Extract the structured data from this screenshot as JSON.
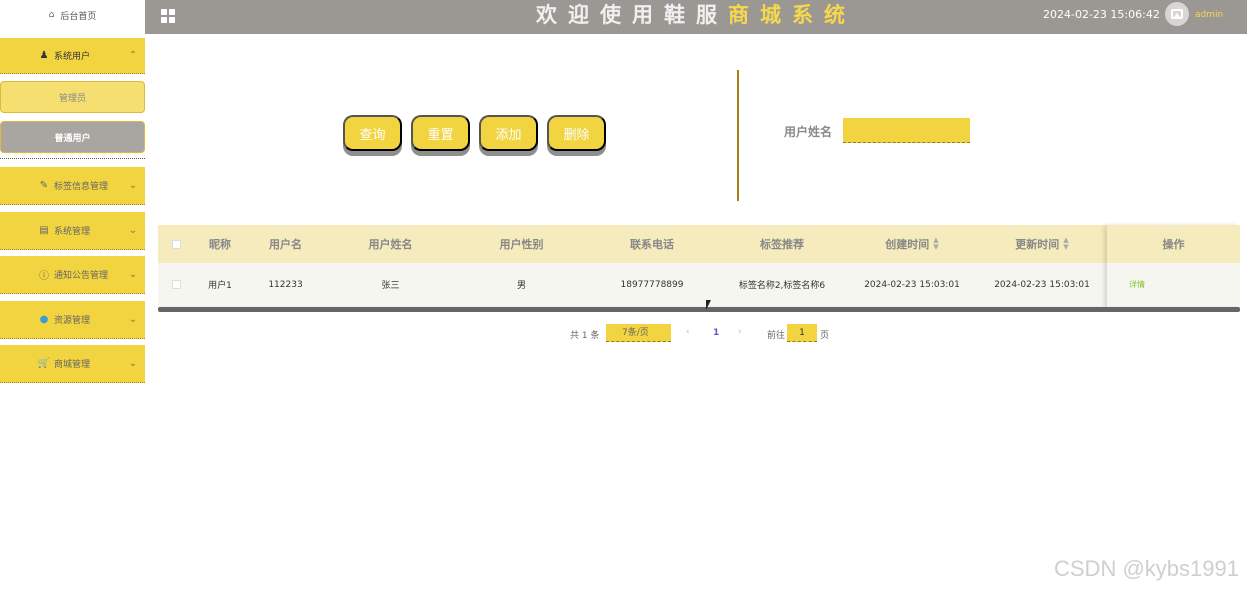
{
  "sidebar": {
    "home": {
      "label": "后台首页",
      "icon": "home-icon"
    },
    "menus": [
      {
        "label": "系统用户",
        "icon": "user-icon",
        "open": true,
        "children": [
          "管理员",
          "普通用户"
        ]
      },
      {
        "label": "标签信息管理",
        "icon": "edit-icon"
      },
      {
        "label": "系统管理",
        "icon": "chart-icon"
      },
      {
        "label": "通知公告管理",
        "icon": "info-icon"
      },
      {
        "label": "资源管理",
        "icon": "location-icon"
      },
      {
        "label": "商城管理",
        "icon": "cart-icon"
      }
    ]
  },
  "header": {
    "title_part1": "欢迎使用鞋服",
    "title_part2": "商城系统",
    "datetime": "2024-02-23 15:06:42",
    "username": "admin"
  },
  "toolbar": {
    "query": "查询",
    "reset": "重置",
    "add": "添加",
    "delete": "删除",
    "search_label": "用户姓名",
    "search_value": ""
  },
  "table": {
    "columns": [
      "昵称",
      "用户名",
      "用户姓名",
      "用户性别",
      "联系电话",
      "标签推荐",
      "创建时间",
      "更新时间",
      "操作"
    ],
    "rows": [
      {
        "nickname": "用户1",
        "username": "112233",
        "realname": "张三",
        "gender": "男",
        "phone": "18977778899",
        "tags": "标签名称2,标签名称6",
        "created": "2024-02-23 15:03:01",
        "updated": "2024-02-23 15:03:01",
        "action": "详情"
      }
    ]
  },
  "pagination": {
    "total": "共 1 条",
    "page_size": "7条/页",
    "current_page": "1",
    "goto_label": "前往",
    "goto_value": "1",
    "page_unit": "页"
  },
  "watermark": "CSDN @kybs1991",
  "colors": {
    "accent": "#f2d340",
    "header_bg": "#9b9893",
    "detail_link": "#7dc12a"
  }
}
